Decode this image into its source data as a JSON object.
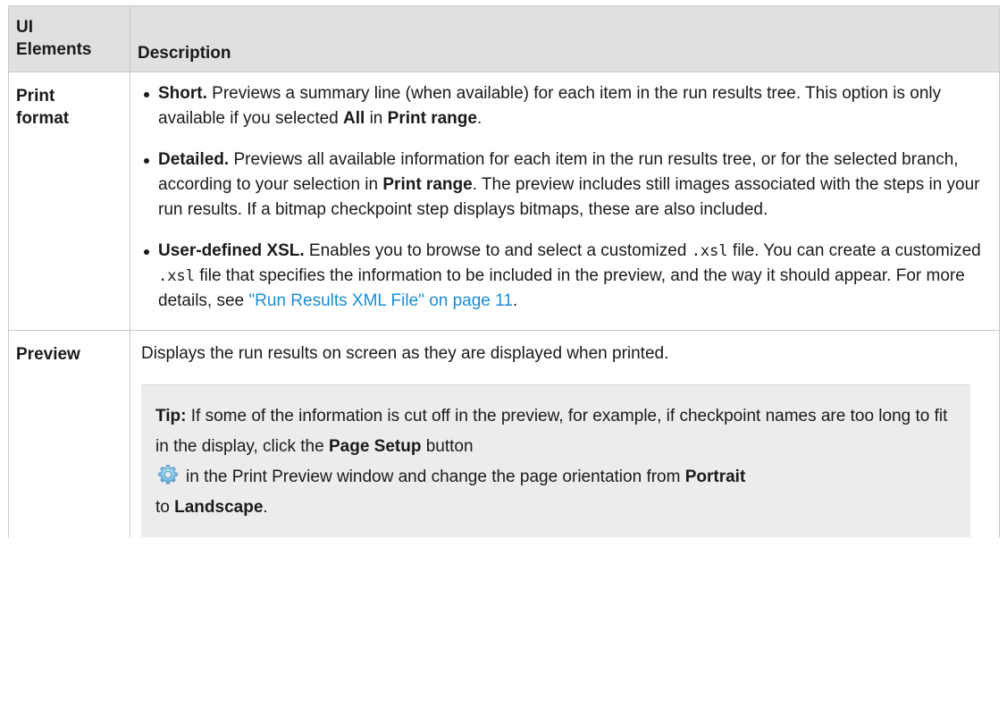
{
  "header": {
    "col1_line1": "UI",
    "col1_line2": "Elements",
    "col2": "Description"
  },
  "rows": {
    "print_format": {
      "label_line1": "Print",
      "label_line2": "format",
      "short": {
        "term": "Short.",
        "text1": " Previews a summary line (when available) for each item in the run results tree. This option is only available if you selected ",
        "all": "All",
        "text2": " in ",
        "print_range": "Print range",
        "text3": "."
      },
      "detailed": {
        "term": "Detailed.",
        "text1": " Previews all available information for each item in the run results tree, or for the selected branch, according to your selection in ",
        "print_range": "Print range",
        "text2": ". The preview includes still images associated with the steps in your run results. If a bitmap checkpoint step displays bitmaps, these are also included."
      },
      "xsl": {
        "term": "User-defined XSL.",
        "text1": " Enables you to browse to and select a customized ",
        "code1": ".xsl",
        "text2": "  file. You can create a customized ",
        "code2": ".xsl",
        "text3": "  file that specifies the information to be included in the preview, and the way it should appear. For more details, see ",
        "link": "\"Run Results XML File\" on page 11",
        "text4": "."
      }
    },
    "preview": {
      "label": "Preview",
      "text": "Displays the run results on screen as they are displayed when printed.",
      "tip": {
        "label": "Tip:",
        "text1": " If some of the information is cut off in the preview, for example, if checkpoint names are too long to fit in the display, click the ",
        "page_setup": "Page Setup",
        "text2": " button",
        "text3": "in the Print Preview window and change the page orientation from ",
        "portrait": "Portrait",
        "text4": " to ",
        "landscape": "Landscape",
        "text5": ".",
        "icon": "gear-icon"
      }
    }
  }
}
